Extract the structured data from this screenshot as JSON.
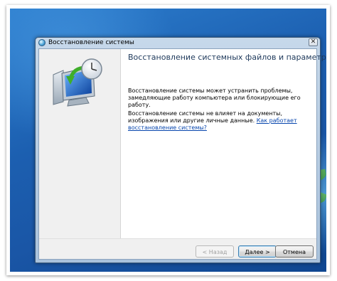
{
  "window": {
    "title": "Восстановление системы",
    "close_symbol": "✕"
  },
  "content": {
    "heading": "Восстановление системных файлов и параметров",
    "paragraph1": "Восстановление системы может устранить проблемы, замедляющие работу компьютера или блокирующие его работу.",
    "paragraph2": "Восстановление системы не влияет на документы, изображения или другие личные данные.",
    "link": "Как работает восстановление системы?"
  },
  "buttons": {
    "back": "< Назад",
    "next": "Далее >",
    "cancel": "Отмена"
  },
  "icons": {
    "title": "system-restore-icon",
    "illustration": "computer-clock-restore-icon",
    "close": "close-icon"
  },
  "colors": {
    "heading": "#1e395b",
    "link": "#0645ad",
    "desktop": "#1c5fb0"
  }
}
